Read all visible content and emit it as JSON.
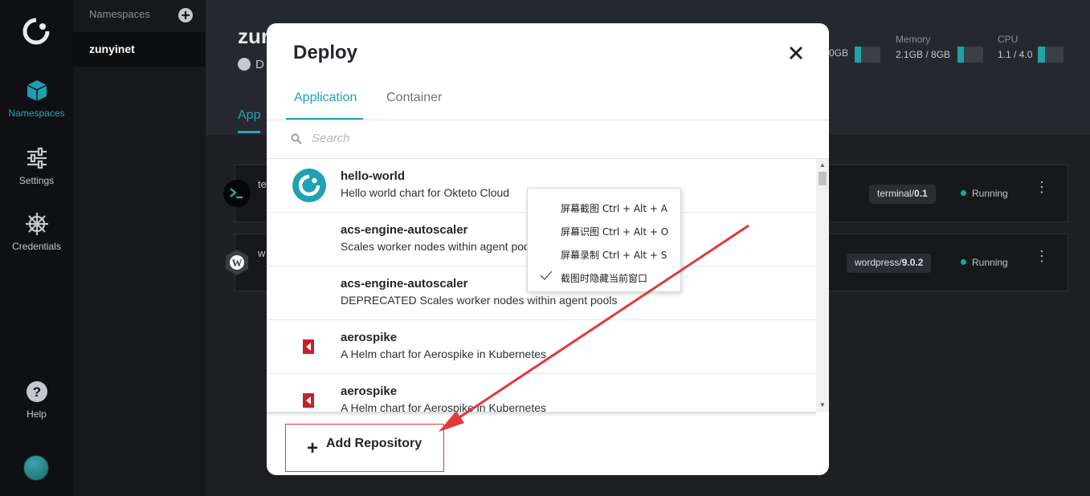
{
  "nav": {
    "items": [
      {
        "label": "Namespaces",
        "icon": "cube-icon",
        "active": true
      },
      {
        "label": "Settings",
        "icon": "sliders-icon",
        "active": false
      },
      {
        "label": "Credentials",
        "icon": "helm-wheel-icon",
        "active": false
      }
    ],
    "help_label": "Help"
  },
  "namespaces": {
    "header": "Namespaces",
    "selected": "zunyinet"
  },
  "main": {
    "title": "zur",
    "subtitle": "D",
    "tab": "App",
    "metrics": [
      {
        "label": "",
        "value": "0GB",
        "fill": 0.25
      },
      {
        "label": "Memory",
        "value": "2.1GB / 8GB",
        "fill": 0.26
      },
      {
        "label": "CPU",
        "value": "1.1 / 4.0",
        "fill": 0.28
      }
    ],
    "apps": [
      {
        "name": "te",
        "chart_name": "terminal/",
        "chart_version": "0.1",
        "status": "Running"
      },
      {
        "name": "w",
        "chart_name": "wordpress/",
        "chart_version": "9.0.2",
        "status": "Running"
      }
    ]
  },
  "modal": {
    "title": "Deploy",
    "tabs": [
      "Application",
      "Container"
    ],
    "active_tab": "Application",
    "search_placeholder": "Search",
    "items": [
      {
        "name": "hello-world",
        "description": "Hello world chart for Okteto Cloud",
        "logo": "okteto-logo"
      },
      {
        "name": "acs-engine-autoscaler",
        "description": "Scales worker nodes within agent pools",
        "logo": ""
      },
      {
        "name": "acs-engine-autoscaler",
        "description": "DEPRECATED Scales worker nodes within agent pools",
        "logo": ""
      },
      {
        "name": "aerospike",
        "description": "A Helm chart for Aerospike in Kubernetes",
        "logo": "aerospike-logo"
      },
      {
        "name": "aerospike",
        "description": "A Helm chart for Aerospike in Kubernetes",
        "logo": "aerospike-logo"
      }
    ],
    "add_repository": "Add Repository"
  },
  "context_menu": {
    "items": [
      {
        "label": "屏幕截图 Ctrl + Alt + A",
        "checked": false
      },
      {
        "label": "屏幕识图 Ctrl + Alt + O",
        "checked": false
      },
      {
        "label": "屏幕录制 Ctrl + Alt + S",
        "checked": false
      },
      {
        "label": "截图时隐藏当前窗口",
        "checked": true
      }
    ]
  },
  "colors": {
    "accent": "#1f9fae",
    "annotation": "#e23a3a"
  }
}
